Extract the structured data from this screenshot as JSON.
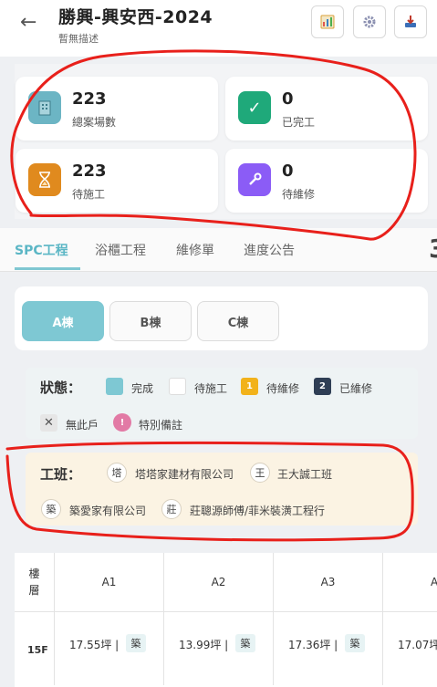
{
  "header": {
    "back_label": "←",
    "title": "勝興-興安西-2024",
    "subtitle": "暫無描述",
    "buttons": [
      {
        "name": "chart-icon",
        "color": "#d9a13b"
      },
      {
        "name": "gear-icon",
        "color": "#8a8fb0"
      },
      {
        "name": "download-icon",
        "color": "#c0392b"
      }
    ]
  },
  "stats": [
    {
      "value": "223",
      "label": "總案場數",
      "icon": "building-icon",
      "color": "#6cb5c4"
    },
    {
      "value": "0",
      "label": "已完工",
      "icon": "check-icon",
      "color": "#1fa97a"
    },
    {
      "value": "223",
      "label": "待施工",
      "icon": "hourglass-icon",
      "color": "#e08a1e"
    },
    {
      "value": "0",
      "label": "待維修",
      "icon": "wrench-icon",
      "color": "#8b5cf6"
    }
  ],
  "tabs": [
    "SPC工程",
    "浴櫃工程",
    "維修單",
    "進度公告"
  ],
  "buildings": [
    "A棟",
    "B棟",
    "C棟"
  ],
  "legend": {
    "title": "狀態：",
    "items": [
      {
        "label": "完成",
        "mark": "",
        "color": "#7ec8d3"
      },
      {
        "label": "待施工",
        "mark": "",
        "color": "#ffffff"
      },
      {
        "label": "待維修",
        "mark": "1",
        "color": "#f2b21b"
      },
      {
        "label": "已維修",
        "mark": "2",
        "color": "#2f3e55"
      },
      {
        "label": "無此戶",
        "mark": "✕",
        "color": "#e6e6e6"
      },
      {
        "label": "特別備註",
        "mark": "!",
        "color": "#e27aa5"
      }
    ]
  },
  "teams": {
    "title": "工班：",
    "items": [
      {
        "avatar": "塔",
        "name": "塔塔家建材有限公司"
      },
      {
        "avatar": "王",
        "name": "王大誠工班"
      },
      {
        "avatar": "築",
        "name": "築愛家有限公司"
      },
      {
        "avatar": "莊",
        "name": "莊聰源師傅/菲米裝潢工程行"
      }
    ]
  },
  "table": {
    "floor_header": "樓\n層",
    "floor_header_top": "樓",
    "floor_header_bottom": "層",
    "columns": [
      "A1",
      "A2",
      "A3",
      "A"
    ],
    "rows": [
      {
        "floor": "15F",
        "cells": [
          {
            "value": "17.55坪 |",
            "tag": "築"
          },
          {
            "value": "13.99坪 |",
            "tag": "築"
          },
          {
            "value": "17.36坪 |",
            "tag": "築"
          },
          {
            "value": "17.07坪",
            "tag": ""
          }
        ]
      }
    ]
  }
}
